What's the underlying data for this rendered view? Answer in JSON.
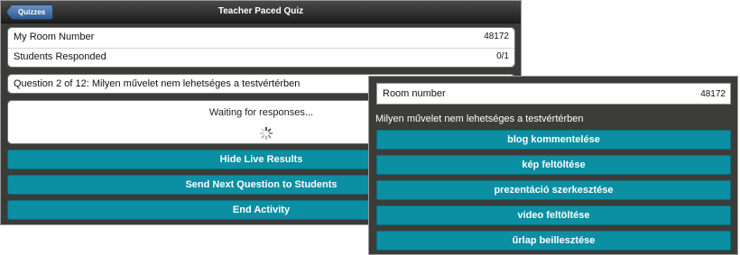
{
  "header": {
    "back_label": "Quizzes",
    "title": "Teacher Paced Quiz"
  },
  "info": {
    "room_label": "My Room Number",
    "room_value": "48172",
    "responded_label": "Students Responded",
    "responded_value": "0/1"
  },
  "question_banner": "Question 2 of 12: Milyen művelet nem lehetséges a testvértérben",
  "status": {
    "waiting_text": "Waiting for responses..."
  },
  "actions": {
    "hide_results": "Hide Live Results",
    "send_next": "Send Next Question to Students",
    "end_activity": "End Activity"
  },
  "student": {
    "room_label": "Room number",
    "room_value": "48172",
    "question": "Milyen művelet nem lehetséges a testvértérben",
    "answers": [
      "blog kommentelése",
      "kép feltöltése",
      "prezentáció szerkesztése",
      "video feltöltése",
      "űrlap beillesztése"
    ]
  },
  "colors": {
    "accent": "#0b8fa3",
    "panel_bg": "#3b3b37"
  }
}
